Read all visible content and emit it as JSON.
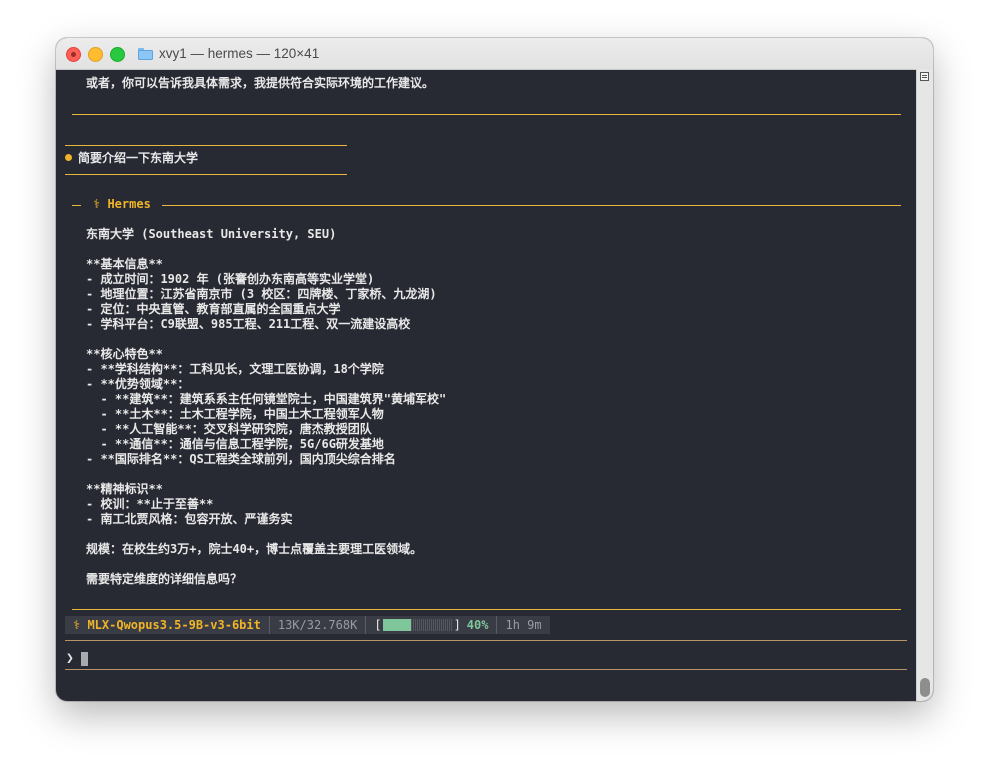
{
  "window": {
    "title": "xvy1 — hermes — 120×41"
  },
  "terminal": {
    "top_line": "或者，你可以告诉我具体需求，我提供符合实际环境的工作建议。",
    "user_message": "简要介绍一下东南大学",
    "hermes_label": "⚕ Hermes",
    "response_lines": [
      "东南大学 (Southeast University, SEU)",
      "",
      "**基本信息**",
      "- 成立时间：1902 年 (张謇创办东南高等实业学堂)",
      "- 地理位置：江苏省南京市 (3 校区：四牌楼、丁家桥、九龙湖)",
      "- 定位：中央直管、教育部直属的全国重点大学",
      "- 学科平台：C9联盟、985工程、211工程、双一流建设高校",
      "",
      "**核心特色**",
      "- **学科结构**：工科见长，文理工医协调，18个学院",
      "- **优势领域**：",
      "  - **建筑**：建筑系系主任何镜堂院士，中国建筑界\"黄埔军校\"",
      "  - **土木**：土木工程学院，中国土木工程领军人物",
      "  - **人工智能**：交叉科学研究院，唐杰教授团队",
      "  - **通信**：通信与信息工程学院，5G/6G研发基地",
      "- **国际排名**：QS工程类全球前列，国内顶尖综合排名",
      "",
      "**精神标识**",
      "- 校训：**止于至善**",
      "- 南工北贾风格：包容开放、严谨务实",
      "",
      "规模：在校生约3万+，院士40+，博士点覆盖主要理工医领域。",
      "",
      "需要特定维度的详细信息吗？"
    ]
  },
  "status_bar": {
    "model": "⚕ MLX-Qwopus3.5-9B-v3-6bit",
    "tokens": "13K/32.768K",
    "bracket_open": "[",
    "bracket_close": "]",
    "context_fraction": 0.4,
    "percent": "40%",
    "elapsed": "1h 9m"
  },
  "prompt": {
    "symbol": "❯"
  },
  "colors": {
    "background": "#282a33",
    "accent": "#f0b429",
    "progress": "#7fc79a"
  }
}
